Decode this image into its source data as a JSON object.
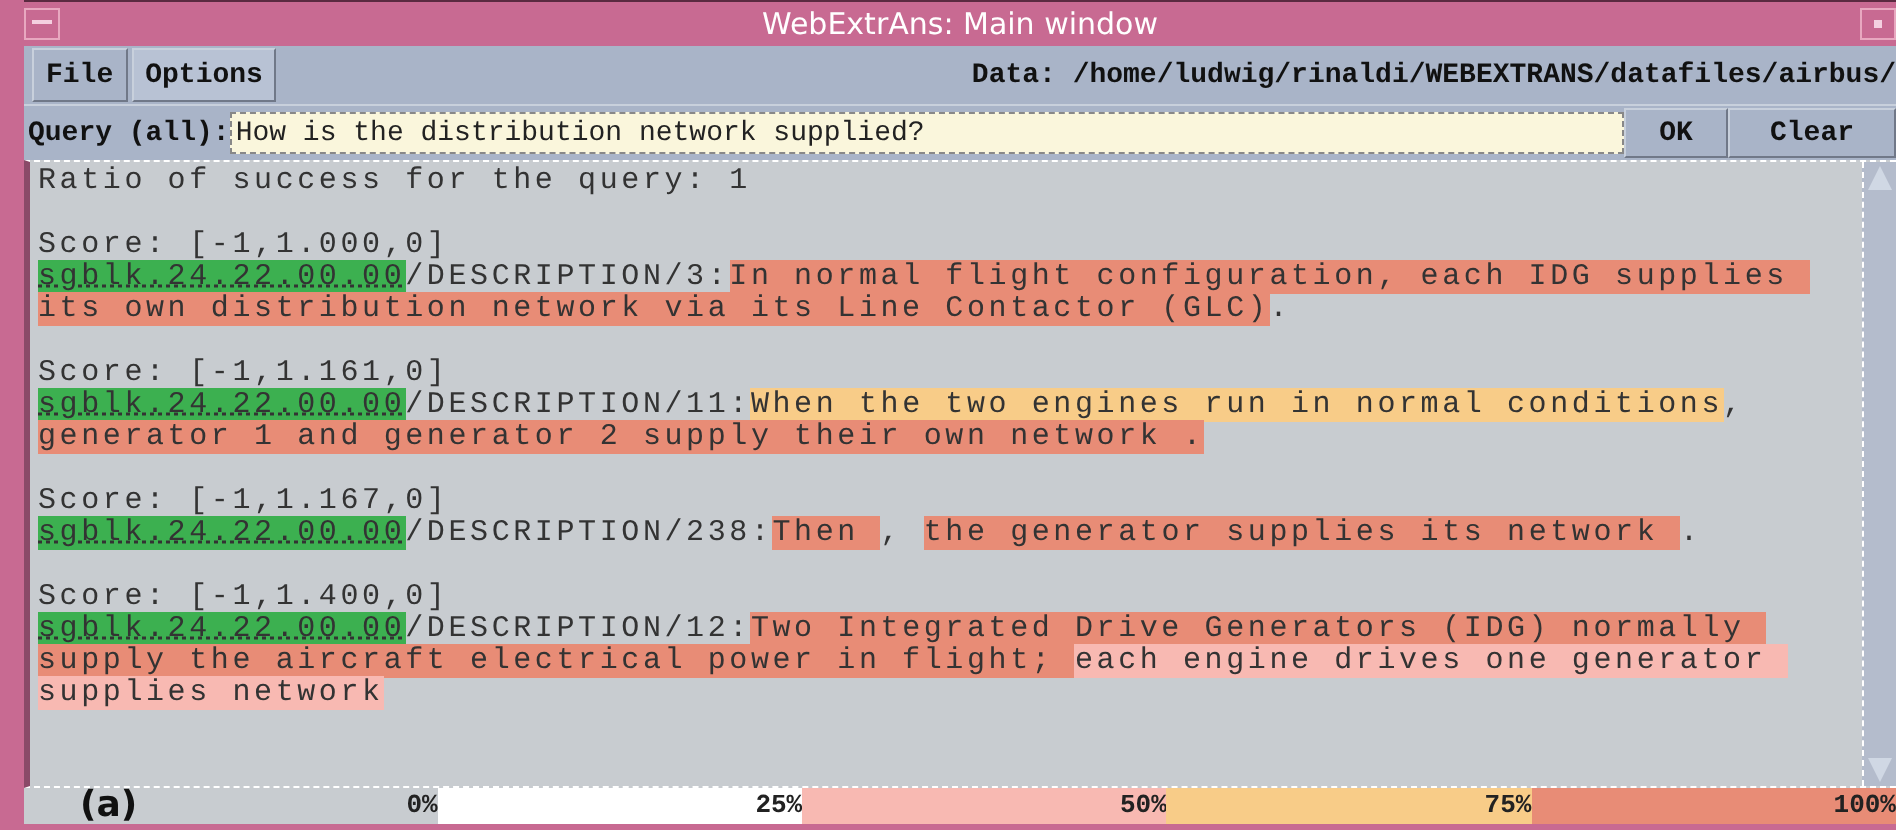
{
  "window": {
    "title": "WebExtrAns: Main window"
  },
  "menu": [
    {
      "label": "File"
    },
    {
      "label": "Options"
    }
  ],
  "data_path": "Data:  /home/ludwig/rinaldi/WEBEXTRANS/datafiles/airbus/",
  "query": {
    "label": "Query (all):",
    "value": "How is the distribution network supplied?",
    "buttons": [
      "OK",
      "Clear"
    ]
  },
  "summary": "Ratio of success for the query: 1",
  "results": [
    {
      "score": "Score: [-1,1.000,0]",
      "doc": "sgblk.24.22.00.00",
      "path": "/DESCRIPTION/3:",
      "segments": [
        {
          "text": "In normal flight configuration, each IDG supplies its own distribution network via its Line Contactor (GLC)",
          "kind": "q4"
        },
        {
          "text": ".",
          "kind": "none"
        }
      ]
    },
    {
      "score": "Score: [-1,1.161,0]",
      "doc": "sgblk.24.22.00.00",
      "path": "/DESCRIPTION/11:",
      "segments": [
        {
          "text": "When the two engines run in normal conditions",
          "kind": "q3"
        },
        {
          "text": ", ",
          "kind": "none"
        },
        {
          "text": "generator 1 and generator 2 supply their own network .",
          "kind": "q4"
        }
      ]
    },
    {
      "score": "Score: [-1,1.167,0]",
      "doc": "sgblk.24.22.00.00",
      "path": "/DESCRIPTION/238:",
      "segments": [
        {
          "text": "Then ",
          "kind": "q4"
        },
        {
          "text": ", ",
          "kind": "none"
        },
        {
          "text": "the generator supplies its network ",
          "kind": "q4"
        },
        {
          "text": ".",
          "kind": "none"
        }
      ]
    },
    {
      "score": "Score: [-1,1.400,0]",
      "doc": "sgblk.24.22.00.00",
      "path": "/DESCRIPTION/12:",
      "segments": [
        {
          "text": "Two Integrated Drive Generators (IDG) normally supply the aircraft electrical power in flight; ",
          "kind": "q4"
        },
        {
          "text": "each engine drives one generator supplies network",
          "kind": "q2"
        }
      ]
    }
  ],
  "caption": "(a)",
  "legend": [
    {
      "label": "0%",
      "kind": "none"
    },
    {
      "label": "25%",
      "kind": "q1"
    },
    {
      "label": "50%",
      "kind": "q2"
    },
    {
      "label": "75%",
      "kind": "q3"
    },
    {
      "label": "100%",
      "kind": "q4"
    }
  ]
}
